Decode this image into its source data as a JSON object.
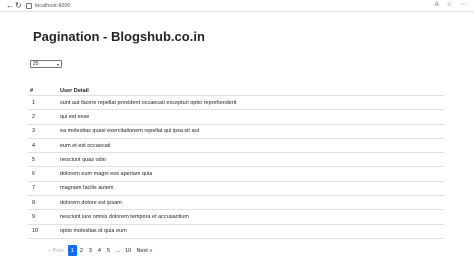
{
  "browser": {
    "back_glyph": "←",
    "refresh_glyph": "↻",
    "url": "localhost:4200",
    "icons": [
      "read-aloud-icon",
      "favorite-icon",
      "more-icon"
    ],
    "read_aloud_glyph": "A",
    "favorite_glyph": "☆",
    "more_glyph": "⋯"
  },
  "page": {
    "title": "Pagination - Blogshub.co.in"
  },
  "page_size": {
    "selected": "25",
    "chevron_glyph": "▾"
  },
  "table": {
    "headers": [
      "#",
      "User Detail"
    ],
    "rows": [
      {
        "num": "1",
        "detail": "sunt aut facere repellat provident occaecati excepturi optio reprehenderit"
      },
      {
        "num": "2",
        "detail": "qui est esse"
      },
      {
        "num": "3",
        "detail": "ea molestias quasi exercitationem repellat qui ipsa sit aut"
      },
      {
        "num": "4",
        "detail": "eum et est occaecati"
      },
      {
        "num": "5",
        "detail": "nesciunt quas odio"
      },
      {
        "num": "6",
        "detail": "dolorem eum magni eos aperiam quia"
      },
      {
        "num": "7",
        "detail": "magnam facilis autem"
      },
      {
        "num": "8",
        "detail": "dolorem dolore est ipsam"
      },
      {
        "num": "9",
        "detail": "nesciunt iure omnis dolorem tempora et accusantium"
      },
      {
        "num": "10",
        "detail": "optio molestias id quia eum"
      }
    ]
  },
  "pagination": {
    "prev": "« Prev",
    "pages": [
      "1",
      "2",
      "3",
      "4",
      "5"
    ],
    "ellipsis": "...",
    "last": "10",
    "next": "Next »",
    "active": "1"
  },
  "colors": {
    "accent": "#0d6efd",
    "text": "#212529",
    "border": "#dee2e6",
    "disabled": "#b3b3b3"
  }
}
